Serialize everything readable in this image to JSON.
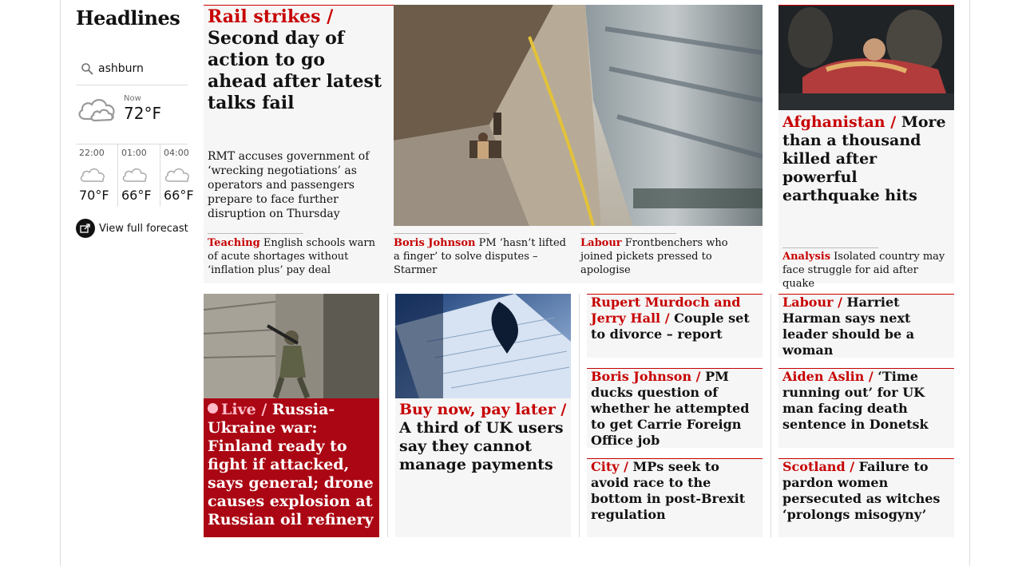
{
  "section_title": "Headlines",
  "weather": {
    "location": "ashburn",
    "now_label": "Now",
    "now_temp": "72°F",
    "forecast": [
      {
        "time": "22:00",
        "temp": "70°F"
      },
      {
        "time": "01:00",
        "temp": "66°F"
      },
      {
        "time": "04:00",
        "temp": "66°F"
      }
    ],
    "full_forecast_label": "View full forecast"
  },
  "main_story": {
    "kicker": "Rail strikes /",
    "headline": "Second day of action to go ahead after latest talks fail",
    "standfirst": "RMT accuses government of ‘wrecking negotiations’ as operators and passengers prepare to face further disruption on Thursday",
    "image": "train-platform-photo",
    "sublinks": [
      {
        "kicker": "Teaching",
        "text": "English schools warn of acute shortages without ‘inflation plus’ pay deal"
      },
      {
        "kicker": "Boris Johnson",
        "text": "PM ‘hasn’t lifted a finger’ to solve disputes – Starmer"
      },
      {
        "kicker": "Labour",
        "text": "Frontbenchers who joined pickets pressed to apologise"
      }
    ]
  },
  "side_story": {
    "kicker": "Afghanistan /",
    "headline": "More than a thousand killed after powerful earthquake hits",
    "image": "earthquake-rescue-photo",
    "sublink": {
      "kicker": "Analysis",
      "text": "Isolated country may face struggle for aid after quake"
    }
  },
  "row2": {
    "live": {
      "kicker": "Live /",
      "headline": "Russia-Ukraine war: Finland ready to fight if attacked, says general; drone causes explosion at Russian oil refinery",
      "image": "soldier-photo"
    },
    "bnpl": {
      "kicker": "Buy now, pay later /",
      "headline": "A third of UK users say they cannot manage payments",
      "image": "laptop-photo"
    },
    "small": [
      {
        "kicker": "Rupert Murdoch and Jerry Hall /",
        "headline": "Couple set to divorce – report"
      },
      {
        "kicker": "Labour /",
        "headline": "Harriet Harman says next leader should be a woman"
      },
      {
        "kicker": "Boris Johnson /",
        "headline": "PM ducks question of whether he attempted to get Carrie Foreign Office job"
      },
      {
        "kicker": "Aiden Aslin /",
        "headline": "‘Time running out’ for UK man facing death sentence in Donetsk"
      },
      {
        "kicker": "City /",
        "headline": "MPs seek to avoid race to the bottom in post-Brexit regulation"
      },
      {
        "kicker": "Scotland /",
        "headline": "Failure to pardon women persecuted as witches ‘prolongs misogyny’"
      }
    ]
  },
  "colors": {
    "news_red": "#c70000",
    "live_bg": "#ab0613",
    "card_bg": "#f6f6f6"
  }
}
